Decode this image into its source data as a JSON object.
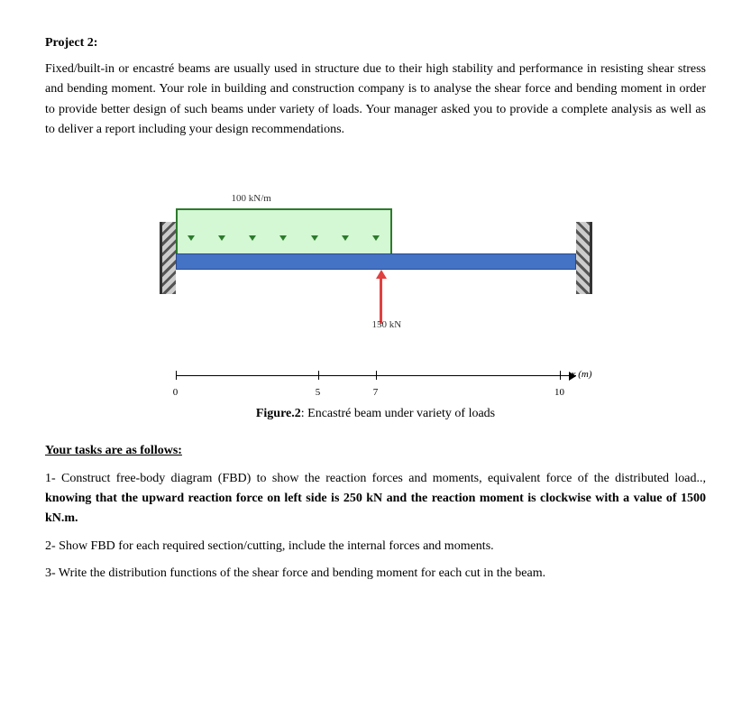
{
  "project": {
    "title": "Project 2:",
    "intro": "Fixed/built-in or encastré beams are usually used in structure due to their high stability and performance in resisting shear stress and bending moment. Your role in building and construction company is to analyse the shear force and bending moment in order to provide better design of such beams under variety of loads. Your manager asked you to provide a complete analysis as well as to deliver a report including your design recommendations."
  },
  "diagram": {
    "dist_load_label": "100 kN/m",
    "force_label": "150 kN",
    "x_axis_label": "x (m)",
    "dim_labels": [
      "0",
      "5",
      "7",
      "10"
    ],
    "figure_caption_bold": "Figure.2",
    "figure_caption_rest": ": Encastré beam under variety of loads"
  },
  "tasks": {
    "heading": "Your tasks are as follows:",
    "task1_start": "1- Construct free-body diagram (FBD) to show the reaction forces and moments, equivalent force of the distributed load.., ",
    "task1_bold": "knowing that the upward reaction force on left side is 250 kN and the reaction moment is clockwise with a value of 1500 kN.m.",
    "task2": "2- Show FBD for each required section/cutting, include the internal forces and moments.",
    "task3": "3- Write the distribution functions of the shear force and bending moment for each cut in the beam."
  }
}
